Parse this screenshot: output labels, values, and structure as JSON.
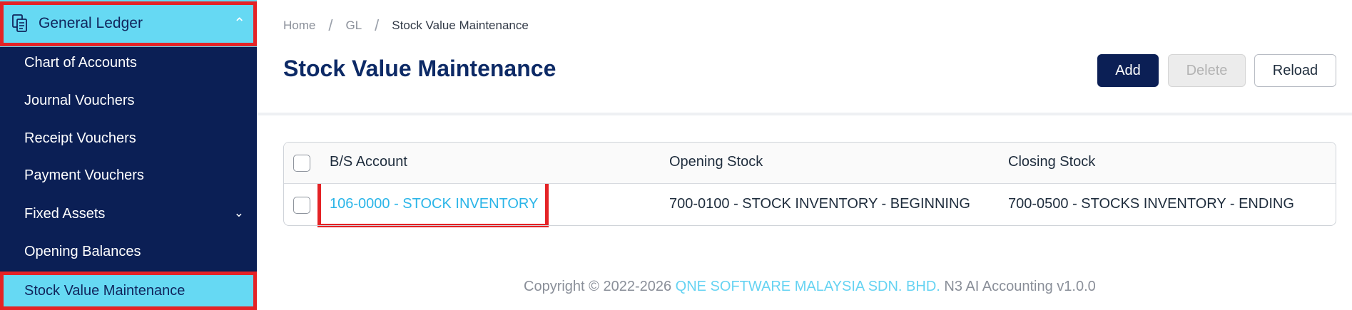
{
  "sidebar": {
    "header": {
      "label": "General Ledger",
      "icon": "ledger-icon",
      "chevron": "chevron-up-icon"
    },
    "items": [
      {
        "label": "Chart of Accounts"
      },
      {
        "label": "Journal Vouchers"
      },
      {
        "label": "Receipt Vouchers"
      },
      {
        "label": "Payment Vouchers"
      },
      {
        "label": "Fixed Assets",
        "chevron": "chevron-down-icon"
      },
      {
        "label": "Opening Balances"
      },
      {
        "label": "Stock Value Maintenance",
        "active": true
      }
    ]
  },
  "breadcrumb": {
    "home": "Home",
    "gl": "GL",
    "current": "Stock Value Maintenance",
    "separator": "/"
  },
  "page": {
    "title": "Stock Value Maintenance"
  },
  "toolbar": {
    "add_label": "Add",
    "delete_label": "Delete",
    "reload_label": "Reload"
  },
  "table": {
    "columns": [
      "B/S Account",
      "Opening Stock",
      "Closing Stock"
    ],
    "rows": [
      {
        "bs_account": "106-0000 - STOCK INVENTORY",
        "opening_stock": "700-0100 - STOCK INVENTORY - BEGINNING",
        "closing_stock": "700-0500 - STOCKS INVENTORY - ENDING"
      }
    ]
  },
  "footer": {
    "prefix": "Copyright © 2022-2026",
    "company": "QNE SOFTWARE MALAYSIA SDN. BHD.",
    "suffix": "N3 AI Accounting v1.0.0"
  },
  "colors": {
    "sidebar_bg": "#0b1f55",
    "accent": "#66d9f3",
    "highlight": "#e42326",
    "link": "#2bb5e8"
  }
}
